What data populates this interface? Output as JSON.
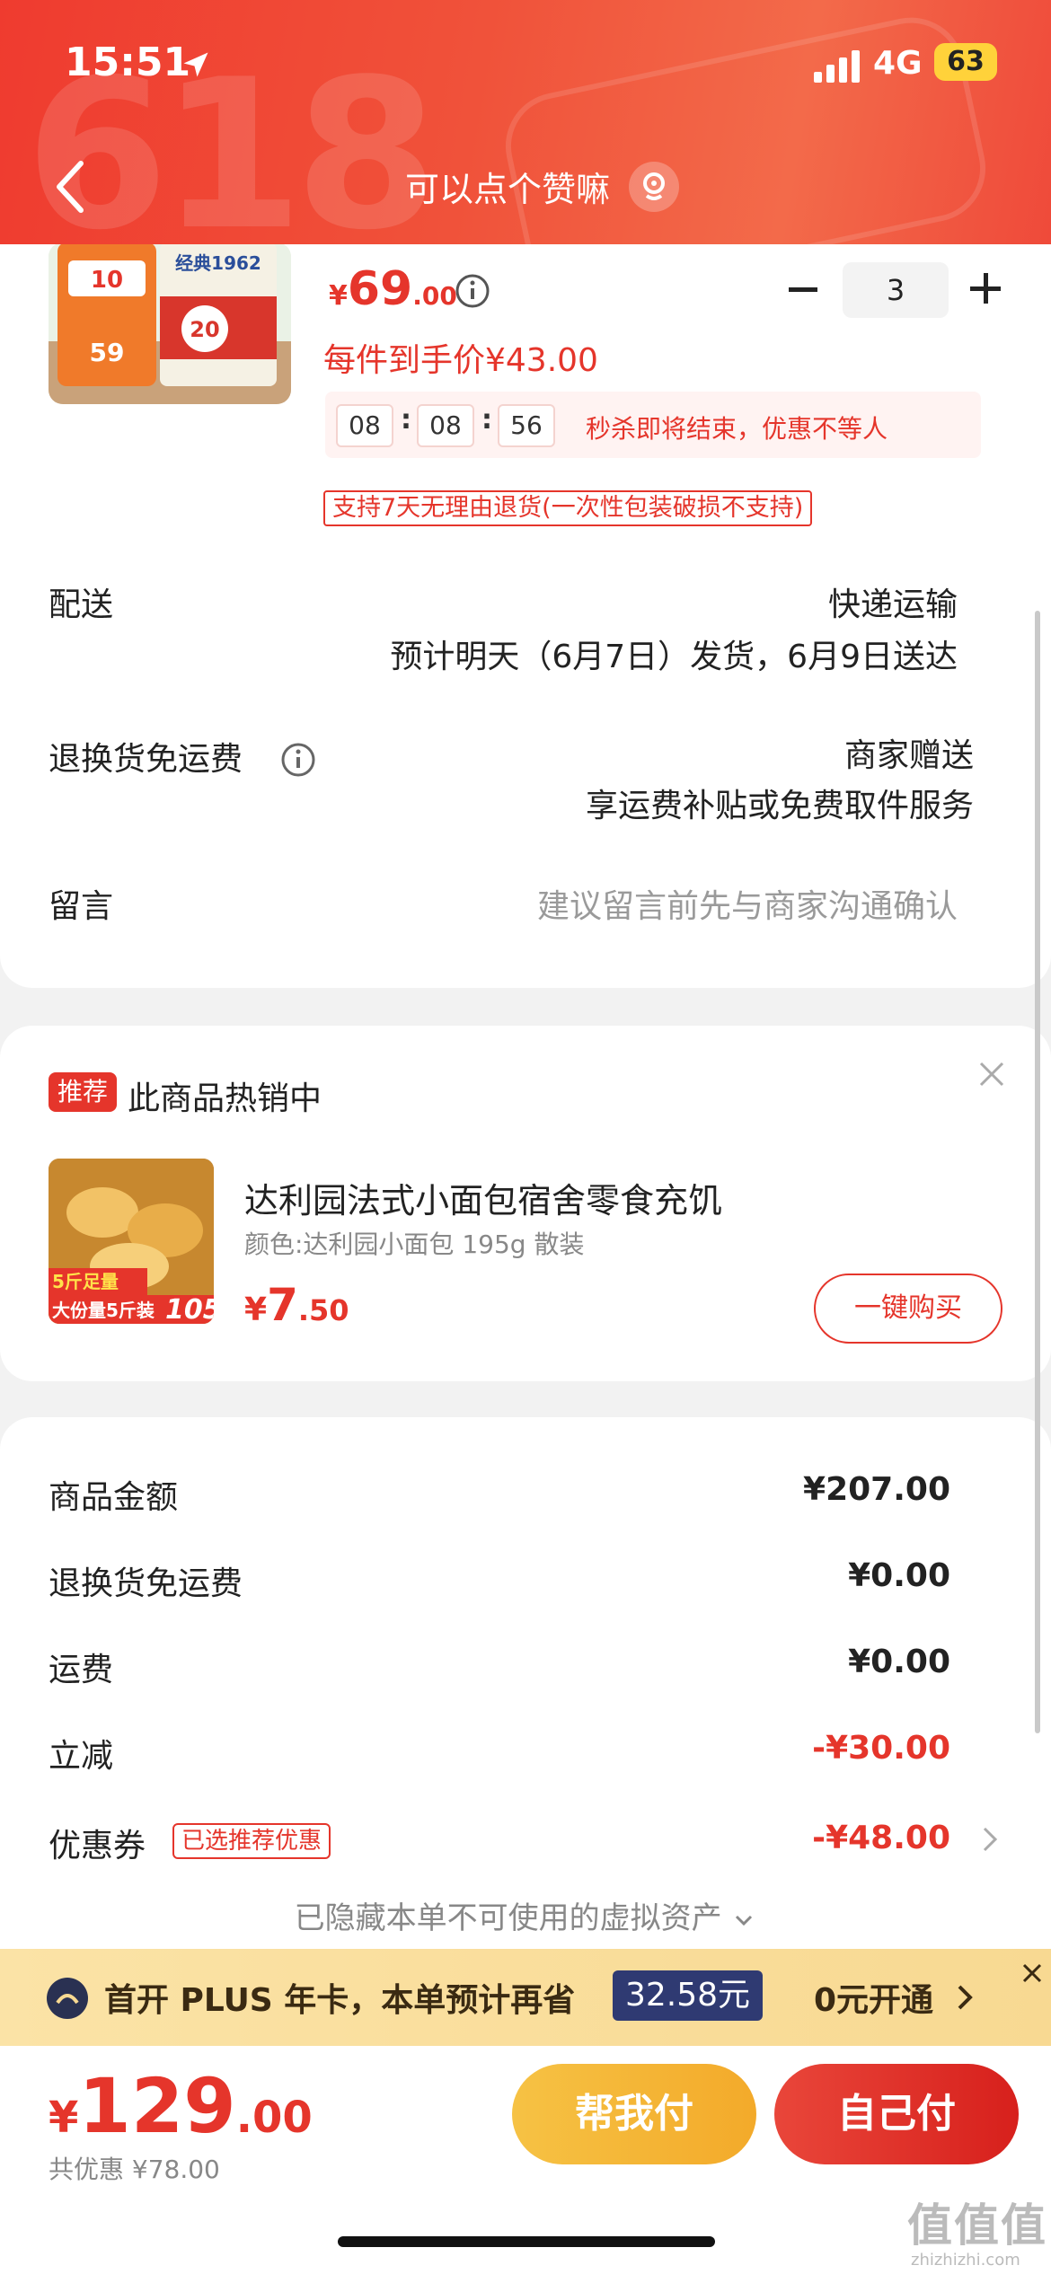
{
  "status_bar": {
    "time": "15:51",
    "network": "4G",
    "battery": "63"
  },
  "header": {
    "title": "可以点个赞嘛"
  },
  "product": {
    "price_currency": "¥",
    "price_int": "69",
    "price_dec": ".00",
    "quantity": "3",
    "unit_price": "每件到手价¥43.00",
    "countdown": [
      "08",
      "08",
      "56"
    ],
    "countdown_note": "秒杀即将结束，优惠不等人",
    "return_tag": "支持7天无理由退货(一次性包装破损不支持)",
    "image_text": {
      "badge_price": "10",
      "label": "经典1962",
      "anniv": "20",
      "small_price": "59"
    }
  },
  "delivery": {
    "label": "配送",
    "method": "快递运输",
    "estimate": "预计明天（6月7日）发货，6月9日送达"
  },
  "return_shipping": {
    "label": "退换货免运费",
    "line1": "商家赠送",
    "line2": "享运费补贴或免费取件服务"
  },
  "message": {
    "label": "留言",
    "placeholder": "建议留言前先与商家沟通确认"
  },
  "recommend": {
    "badge": "推荐",
    "title": "此商品热销中",
    "name": "达利园法式小面包宿舍零食充饥",
    "spec": "颜色:达利园小面包 195g 散装",
    "price_currency": "¥",
    "price_int": "7",
    "price_dec": ".50",
    "buy_label": "一键购买",
    "image_text": {
      "line1": "5斤足量",
      "line2": "大份量5斤装",
      "num": "105"
    }
  },
  "summary": {
    "rows": [
      {
        "label": "商品金额",
        "value": "¥207.00"
      },
      {
        "label": "退换货免运费",
        "value": "¥0.00"
      },
      {
        "label": "运费",
        "value": "¥0.00"
      },
      {
        "label": "立减",
        "value": "-¥30.00"
      },
      {
        "label": "优惠券",
        "value": "-¥48.00"
      }
    ],
    "coupon_tag": "已选推荐优惠",
    "hidden_assets": "已隐藏本单不可使用的虚拟资产"
  },
  "plus_banner": {
    "text": "首开 PLUS 年卡，本单预计再省",
    "amount": "32.58元",
    "action": "0元开通"
  },
  "bottom": {
    "currency": "¥",
    "total_int": "129",
    "total_dec": ".00",
    "saving": "共优惠 ¥78.00",
    "help_pay": "帮我付",
    "self_pay": "自己付"
  },
  "watermark": {
    "logo": "值值值",
    "site": "zhizhizhi.com"
  },
  "colors": {
    "accent": "#e5352b",
    "header_bg": "#ef3b2f",
    "plus_bg": "#fbe3a6",
    "help_btn": "#f6c244"
  }
}
